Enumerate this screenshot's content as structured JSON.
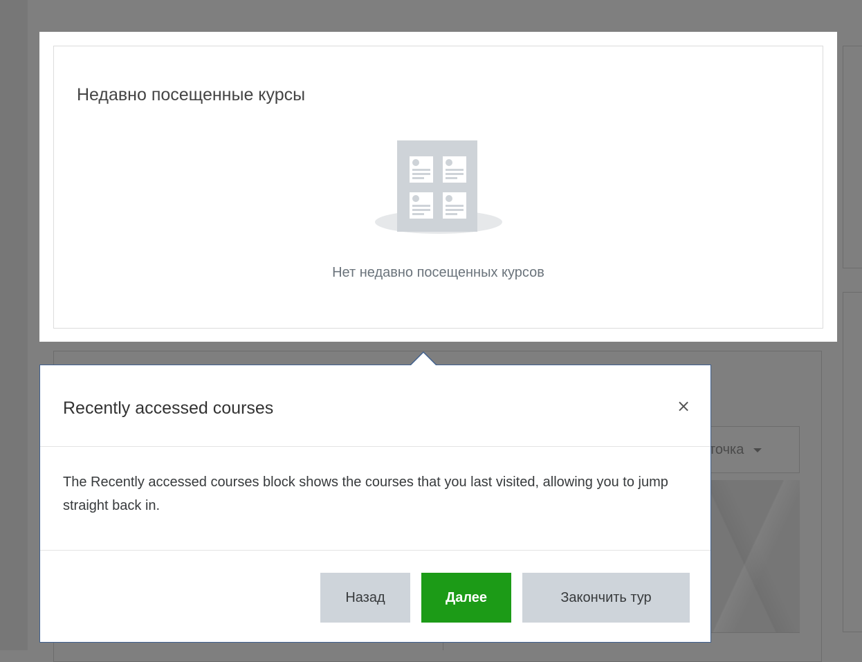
{
  "background": {
    "dropdown_label": "точка"
  },
  "block": {
    "title": "Недавно посещенные курсы",
    "empty_message": "Нет недавно посещенных курсов",
    "illustration_icon": "courses-empty-icon"
  },
  "tour": {
    "title": "Recently accessed courses",
    "close_symbol": "×",
    "body": "The Recently accessed courses block shows the courses that you last visited, allowing you to jump straight back in.",
    "back_label": "Назад",
    "next_label": "Далее",
    "end_label": "Закончить тур"
  },
  "colors": {
    "next_button": "#1c9b17",
    "secondary_button": "#ced4da",
    "popover_border": "#3d5f8f",
    "backdrop": "#7f7f7f"
  }
}
